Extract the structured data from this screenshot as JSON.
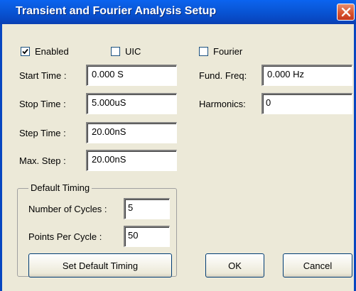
{
  "window": {
    "title": "Transient and Fourier Analysis Setup"
  },
  "options": {
    "enabled": {
      "label": "Enabled",
      "checked": true
    },
    "uic": {
      "label": "UIC",
      "checked": false
    },
    "fourier": {
      "label": "Fourier",
      "checked": false
    }
  },
  "timing": {
    "start_time": {
      "label": "Start Time :",
      "value": "0.000 S"
    },
    "stop_time": {
      "label": "Stop Time :",
      "value": "5.000uS"
    },
    "step_time": {
      "label": "Step Time :",
      "value": "20.00nS"
    },
    "max_step": {
      "label": "Max. Step :",
      "value": "20.00nS"
    }
  },
  "fourier_settings": {
    "fund_freq": {
      "label": "Fund. Freq:",
      "value": "0.000 Hz"
    },
    "harmonics": {
      "label": "Harmonics:",
      "value": "0"
    }
  },
  "default_timing": {
    "legend": "Default Timing",
    "cycles": {
      "label": "Number of Cycles :",
      "value": "5"
    },
    "points": {
      "label": "Points Per Cycle :",
      "value": "50"
    },
    "set_button": "Set Default Timing"
  },
  "buttons": {
    "ok": "OK",
    "cancel": "Cancel"
  }
}
